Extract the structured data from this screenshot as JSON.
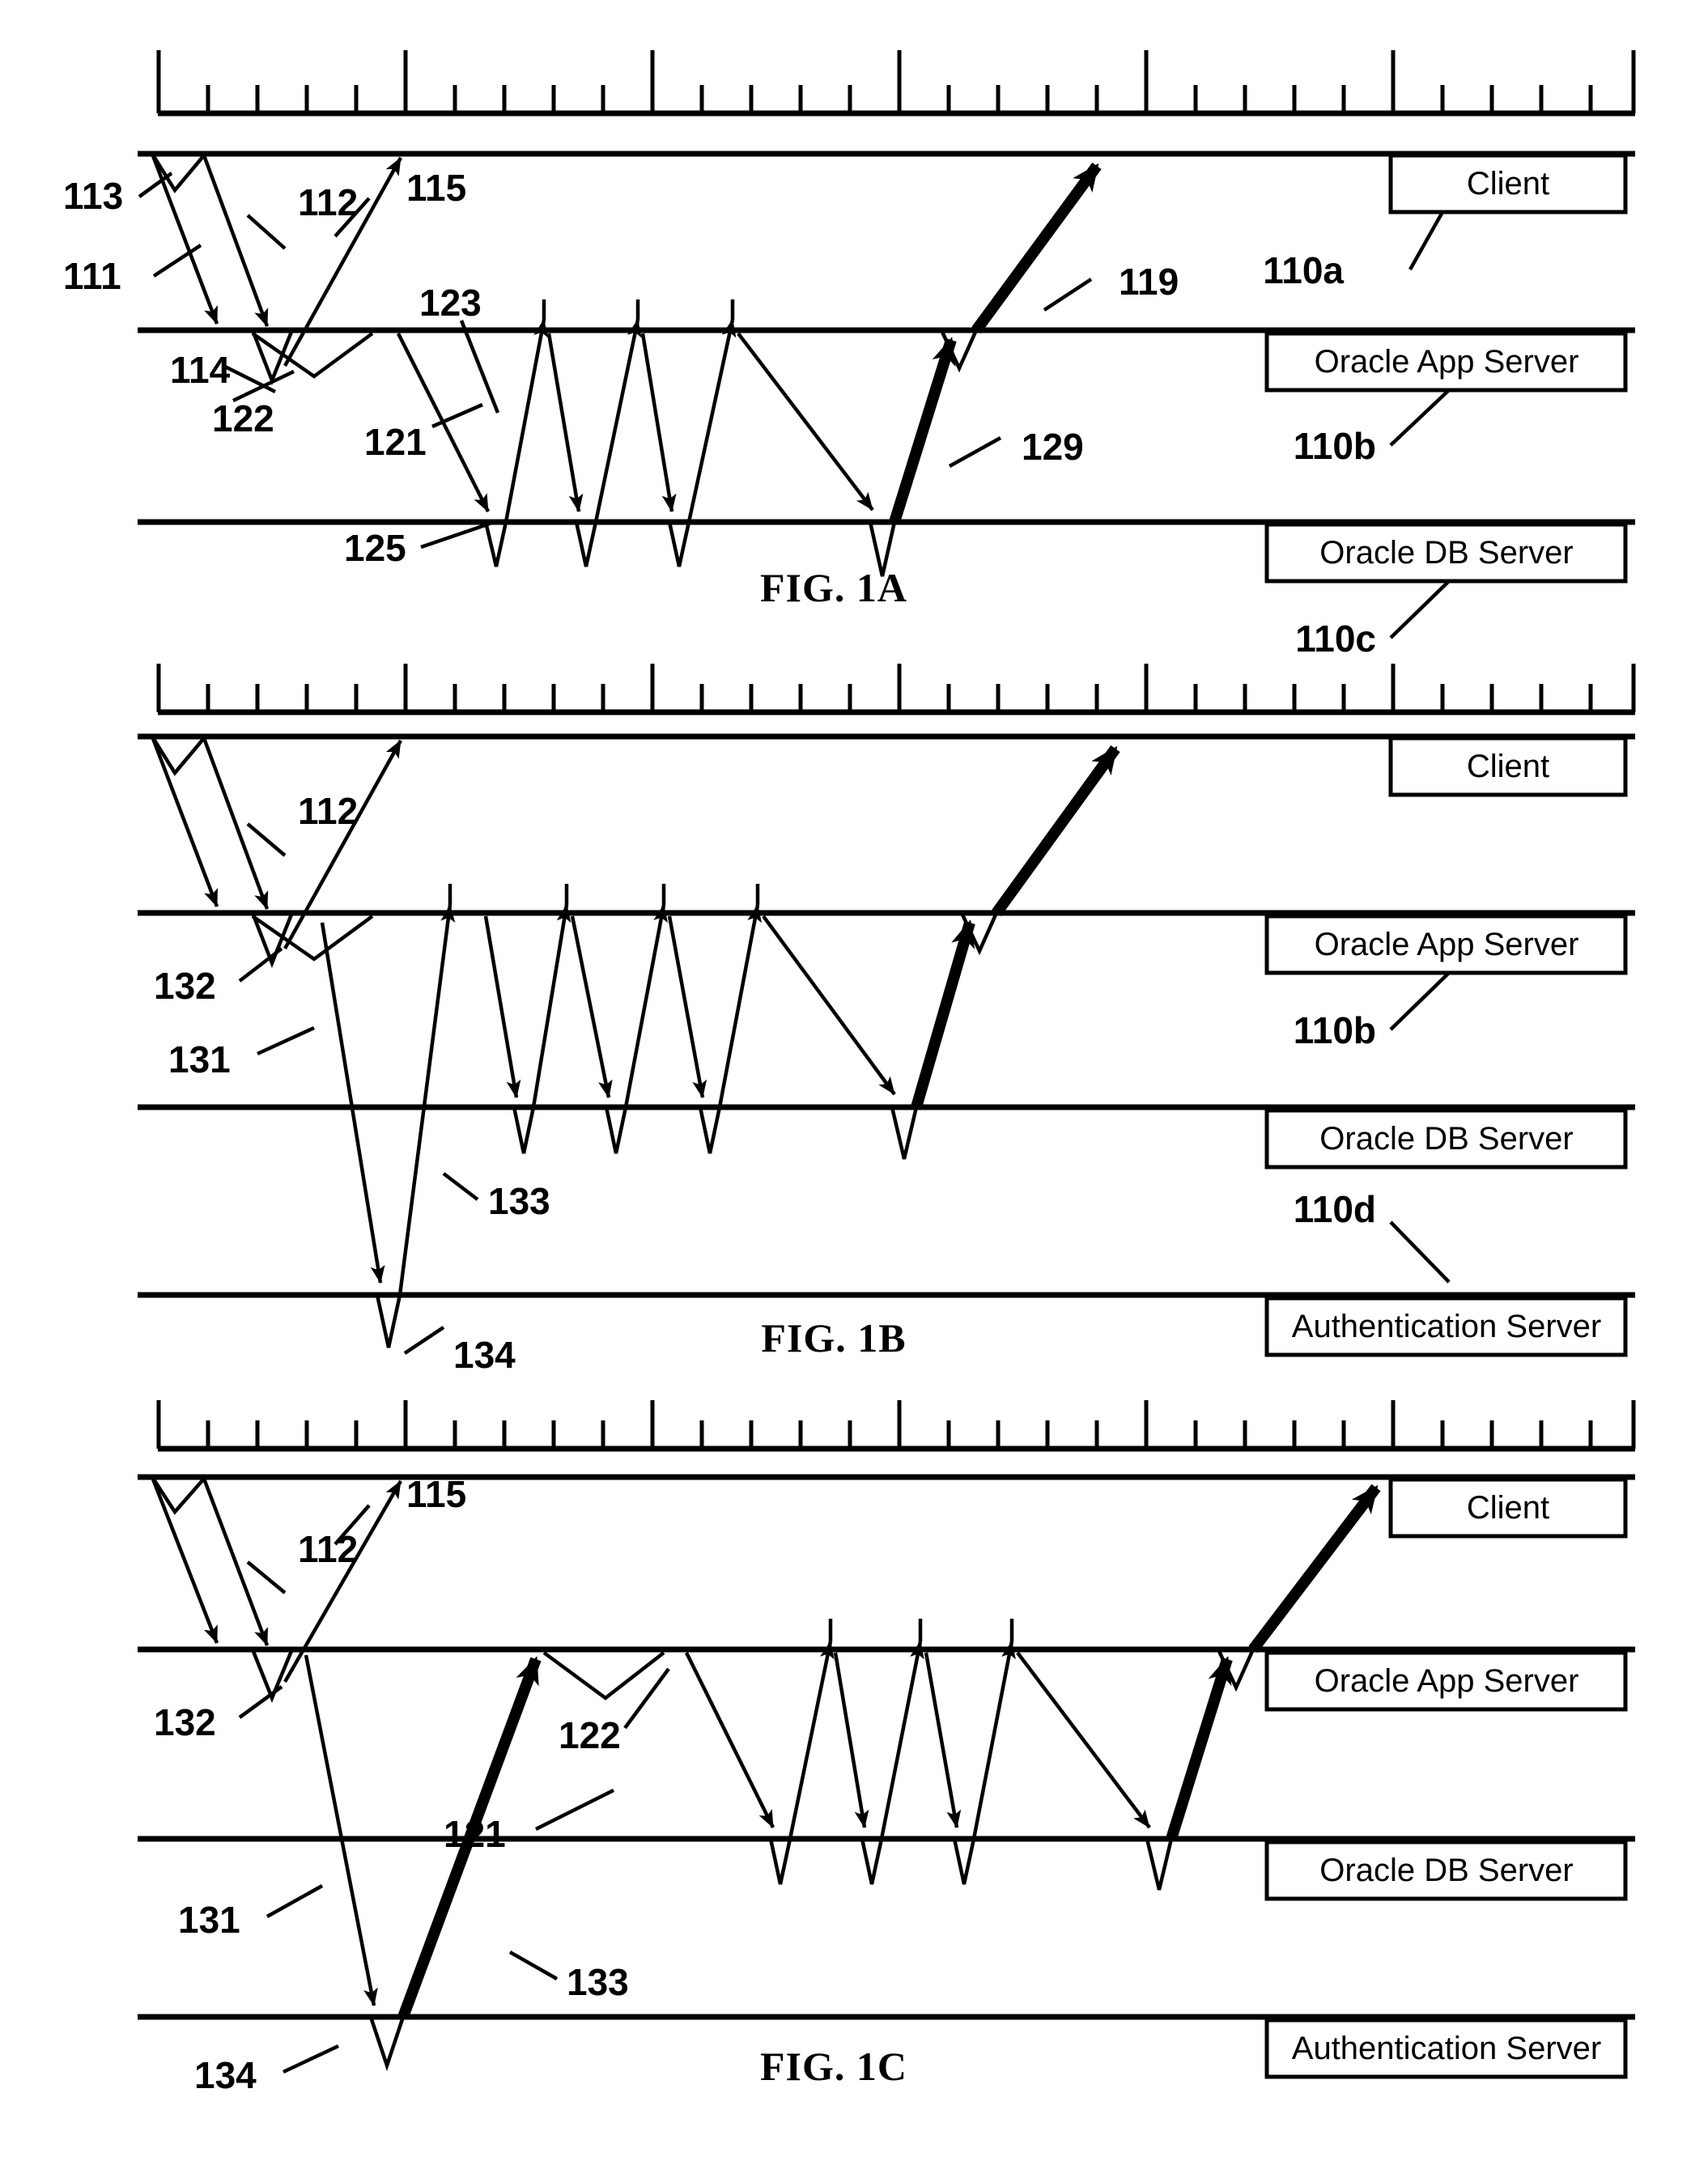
{
  "document": {
    "type": "patent-figure-sheet",
    "figures": [
      {
        "id": "fig1a",
        "caption": "FIG. 1A",
        "lifelines": [
          {
            "key": "client",
            "label": "Client",
            "ref": "110a"
          },
          {
            "key": "appsrv",
            "label": "Oracle App Server",
            "ref": "110b"
          },
          {
            "key": "dbsrv",
            "label": "Oracle DB Server",
            "ref": "110c"
          }
        ],
        "callouts": [
          "113",
          "111",
          "112",
          "115",
          "119",
          "114",
          "122",
          "123",
          "121",
          "125",
          "129"
        ]
      },
      {
        "id": "fig1b",
        "caption": "FIG. 1B",
        "lifelines": [
          {
            "key": "client",
            "label": "Client",
            "ref": ""
          },
          {
            "key": "appsrv",
            "label": "Oracle App Server",
            "ref": "110b"
          },
          {
            "key": "dbsrv",
            "label": "Oracle DB Server",
            "ref": ""
          },
          {
            "key": "authsrv",
            "label": "Authentication Server",
            "ref": "110d"
          }
        ],
        "callouts": [
          "112",
          "132",
          "131",
          "133",
          "134"
        ]
      },
      {
        "id": "fig1c",
        "caption": "FIG. 1C",
        "lifelines": [
          {
            "key": "client",
            "label": "Client",
            "ref": ""
          },
          {
            "key": "appsrv",
            "label": "Oracle App Server",
            "ref": ""
          },
          {
            "key": "dbsrv",
            "label": "Oracle DB Server",
            "ref": ""
          },
          {
            "key": "authsrv",
            "label": "Authentication Server",
            "ref": ""
          }
        ],
        "callouts": [
          "112",
          "115",
          "132",
          "122",
          "121",
          "131",
          "133",
          "134"
        ]
      }
    ],
    "ruler": {
      "major_tick_every": 5,
      "tick_count": 31
    }
  },
  "fig1a": {
    "caption": "FIG. 1A",
    "box_client": "Client",
    "box_app": "Oracle App Server",
    "box_db": "Oracle DB Server",
    "ref_110a": "110a",
    "ref_110b": "110b",
    "ref_110c": "110c",
    "n113": "113",
    "n111": "111",
    "n112": "112",
    "n115": "115",
    "n119": "119",
    "n114": "114",
    "n122": "122",
    "n123": "123",
    "n121": "121",
    "n125": "125",
    "n129": "129"
  },
  "fig1b": {
    "caption": "FIG. 1B",
    "box_client": "Client",
    "box_app": "Oracle App Server",
    "box_db": "Oracle DB Server",
    "box_auth": "Authentication Server",
    "ref_110b": "110b",
    "ref_110d": "110d",
    "n112": "112",
    "n132": "132",
    "n131": "131",
    "n133": "133",
    "n134": "134"
  },
  "fig1c": {
    "caption": "FIG. 1C",
    "box_client": "Client",
    "box_app": "Oracle App Server",
    "box_db": "Oracle DB Server",
    "box_auth": "Authentication Server",
    "n112": "112",
    "n115": "115",
    "n132": "132",
    "n122": "122",
    "n121": "121",
    "n131": "131",
    "n133": "133",
    "n134": "134"
  }
}
